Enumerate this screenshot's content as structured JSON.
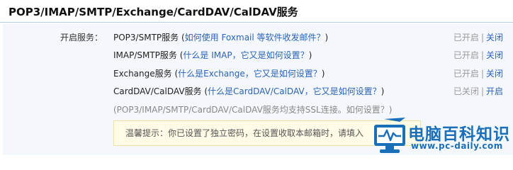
{
  "header": {
    "title": "POP3/IMAP/SMTP/Exchange/CardDAV/CalDAV服务"
  },
  "services": {
    "label": "开启服务：",
    "rows": [
      {
        "name": "POP3/SMTP服务",
        "paren_open": " (",
        "help": "如何使用 Foxmail 等软件收发邮件？",
        "paren_close": ")",
        "status_text": "已开启",
        "separator": "|",
        "action": "关闭"
      },
      {
        "name": "IMAP/SMTP服务",
        "paren_open": " (",
        "help": "什么是 IMAP，它又是如何设置？",
        "paren_close": ")",
        "status_text": "已开启",
        "separator": "|",
        "action": "关闭"
      },
      {
        "name": "Exchange服务",
        "paren_open": " (",
        "help": "什么是Exchange，它又是如何设置？",
        "paren_close": ")",
        "status_text": "已开启",
        "separator": "|",
        "action": "关闭"
      },
      {
        "name": "CardDAV/CalDAV服务",
        "paren_open": " (",
        "help": "什么是CardDAV/CalDAV，它又是如何设置？",
        "paren_close": ")",
        "status_text": "已关闭",
        "separator": "|",
        "action": "开启"
      }
    ],
    "ssl_note": "(POP3/IMAP/SMTP/CardDAV/CalDAV服务均支持SSL连接。",
    "ssl_link": "如何设置？",
    "ssl_close": ")"
  },
  "tip": {
    "text": "温馨提示：你已设置了独立密码，在设置收取本邮箱时，请填入"
  },
  "watermark": {
    "title": "电脑百科知识",
    "url": "www.pc-daily.com"
  },
  "colors": {
    "link": "#2a62b5",
    "panel_bg": "#f4f8fc",
    "tip_bg": "#fffbe6",
    "watermark": "#1a6fb8"
  }
}
